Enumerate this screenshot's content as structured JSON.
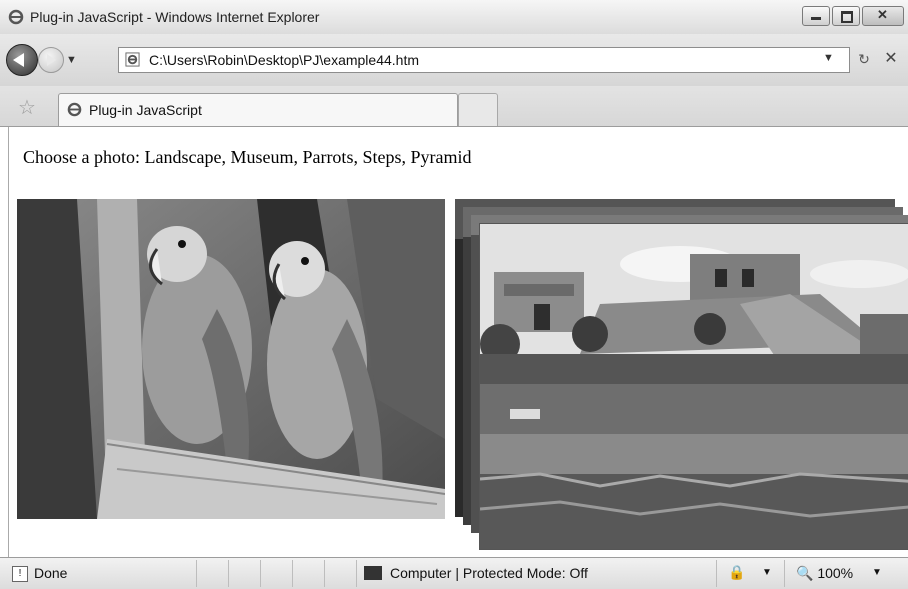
{
  "window": {
    "title": "Plug-in JavaScript - Windows Internet Explorer"
  },
  "navigation": {
    "address": "C:\\Users\\Robin\\Desktop\\PJ\\example44.htm",
    "refresh_glyph": "↻",
    "stop_glyph": "✕"
  },
  "tabs": [
    {
      "label": "Plug-in JavaScript",
      "active": true
    }
  ],
  "content": {
    "prompt": "Choose a photo: Landscape, Museum, Parrots, Steps, Pyramid",
    "main_photo": "Parrots",
    "stack_front_photo": "Pyramid"
  },
  "status": {
    "state": "Done",
    "zone": "Computer | Protected Mode: Off",
    "zoom": "100%"
  },
  "icons": [
    "ie-icon",
    "back-icon",
    "forward-icon",
    "favorites-star-icon",
    "computer-icon",
    "security-icon",
    "zoom-icon"
  ]
}
